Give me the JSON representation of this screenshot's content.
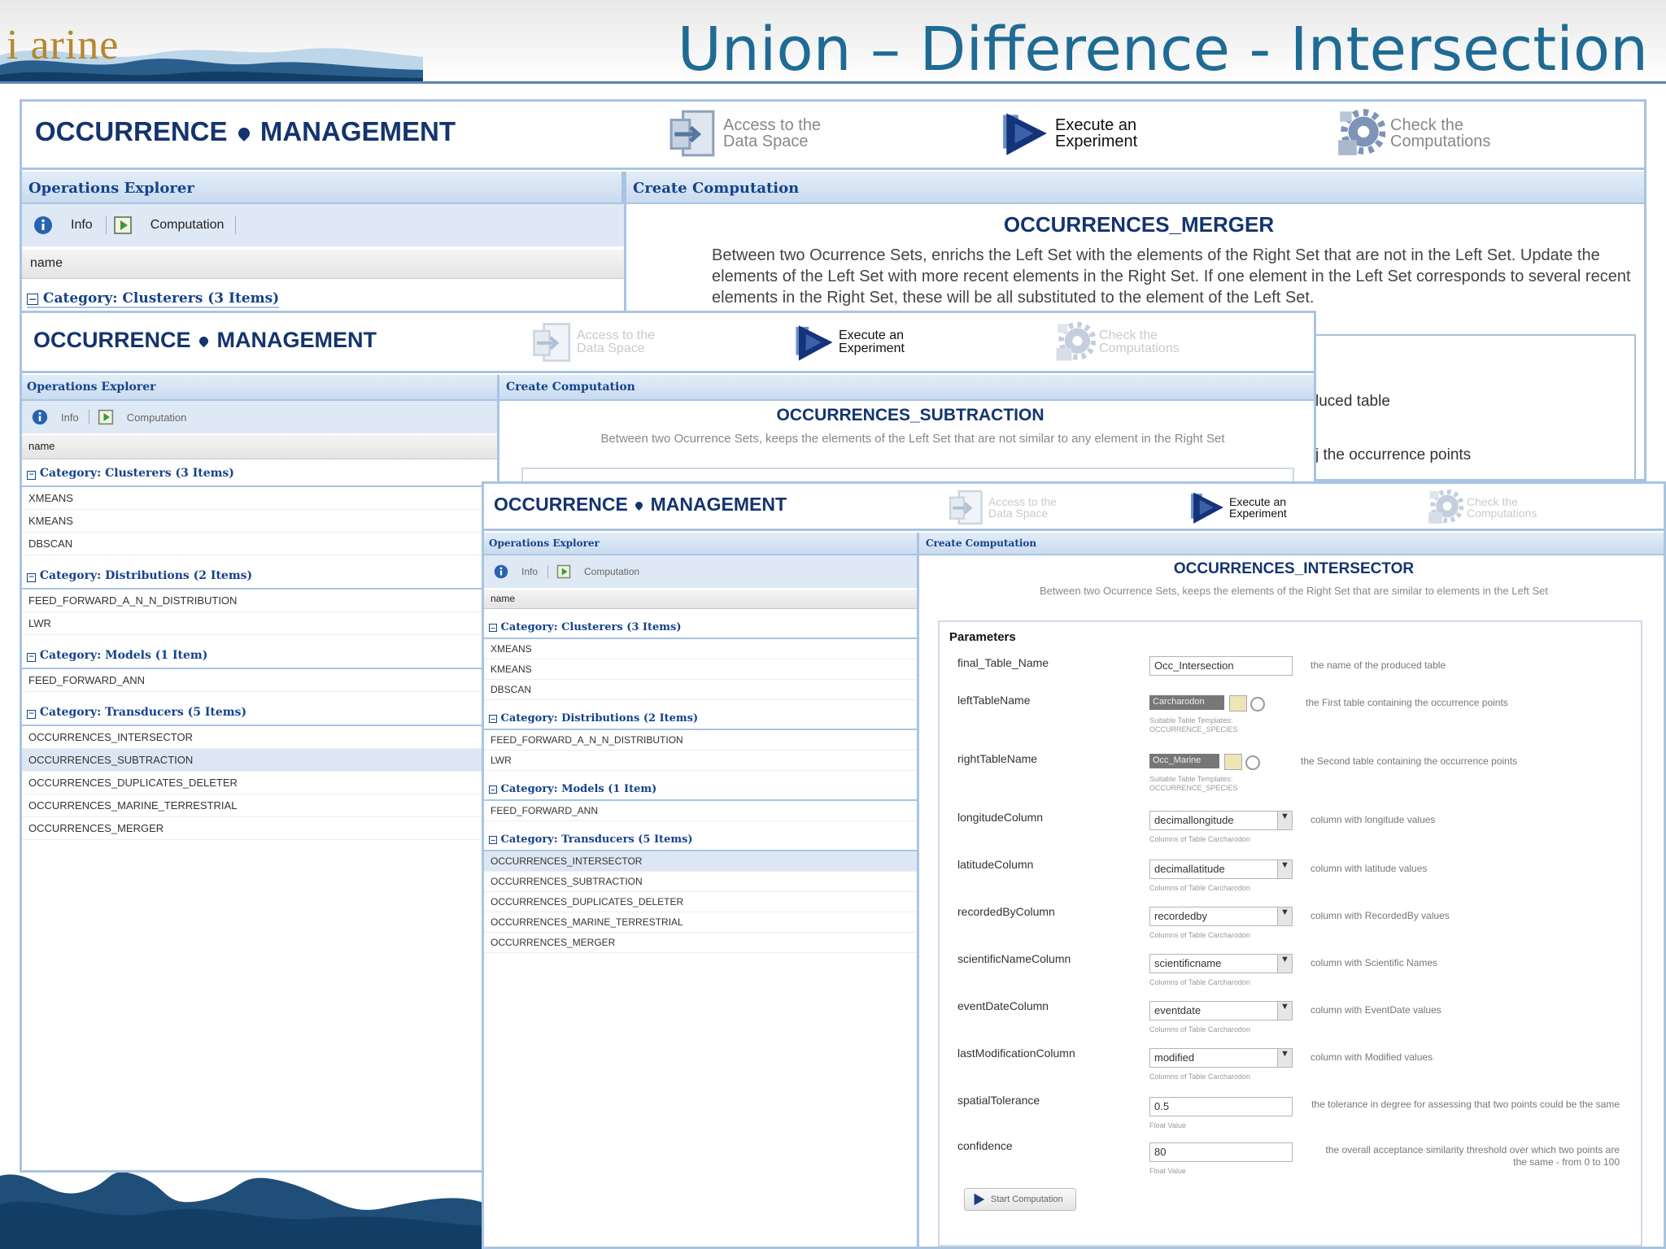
{
  "slide": {
    "title": "Union – Difference - Intersection",
    "logo_text": "i arine",
    "colors": {
      "title": "#1f6b94",
      "wave": "#1f4f78",
      "app_title": "#14346e",
      "section_header_text": "#15428b",
      "panel_border": "#a9c4e2"
    }
  },
  "app": {
    "title_left": "OCCURRENCE",
    "title_right": "MANAGEMENT",
    "nav": {
      "access": "Access to the\nData Space",
      "execute": "Execute an\nExperiment",
      "check": "Check the\nComputations"
    },
    "icons": [
      "access-data-space-icon",
      "execute-experiment-icon",
      "check-computations-icon",
      "info-icon",
      "computation-icon",
      "start-computation-icon",
      "collapse-icon"
    ],
    "explorer_title": "Operations Explorer",
    "computation_title": "Create Computation",
    "toolbar": {
      "info": "Info",
      "computation": "Computation"
    },
    "name_column": "name"
  },
  "categories": {
    "clusterers": {
      "label": "Category: Clusterers (3 Items)",
      "items": [
        "XMEANS",
        "KMEANS",
        "DBSCAN"
      ]
    },
    "distributions": {
      "label": "Category: Distributions (2 Items)",
      "items": [
        "FEED_FORWARD_A_N_N_DISTRIBUTION",
        "LWR"
      ]
    },
    "models": {
      "label": "Category: Models (1 Item)",
      "items": [
        "FEED_FORWARD_ANN"
      ]
    },
    "transducers": {
      "label": "Category: Transducers (5 Items)",
      "items": [
        "OCCURRENCES_INTERSECTOR",
        "OCCURRENCES_SUBTRACTION",
        "OCCURRENCES_DUPLICATES_DELETER",
        "OCCURRENCES_MARINE_TERRESTRIAL",
        "OCCURRENCES_MERGER"
      ]
    }
  },
  "merger": {
    "name": "OCCURRENCES_MERGER",
    "description": "Between two Ocurrence Sets, enrichs the Left Set with the elements of the Right Set that are not in the Left Set. Update the elements of the Left Set with more recent elements in the Right Set. If one element in the Left Set corresponds to several recent elements in the Right Set, these will be all substituted to the element of the Left Set.",
    "partial_texts": [
      "luced table",
      "j the occurrence points"
    ]
  },
  "subtraction": {
    "name": "OCCURRENCES_SUBTRACTION",
    "description": "Between two Ocurrence Sets, keeps the elements of the Left Set that are not similar to any element in the Right Set"
  },
  "intersector": {
    "name": "OCCURRENCES_INTERSECTOR",
    "description": "Between two Ocurrence Sets, keeps the elements of the Right Set that are similar to elements in the Left Set",
    "params_title": "Parameters",
    "start_label": "Start Computation",
    "params": {
      "final_table_name": {
        "label": "final_Table_Name",
        "value": "Occ_Intersection",
        "desc": "the name of the produced table"
      },
      "left_table_name": {
        "label": "leftTableName",
        "value": "Carcharodon",
        "desc": "the First table containing the occurrence points",
        "hint": "Suitable Table Templates:\nOCCURRENCE_SPECIES"
      },
      "right_table_name": {
        "label": "rightTableName",
        "value": "Occ_Marine",
        "desc": "the Second table containing the occurrence points",
        "hint": "Suitable Table Templates:\nOCCURRENCE_SPECIES"
      },
      "longitude_column": {
        "label": "longitudeColumn",
        "value": "decimallongitude",
        "desc": "column with longitude values",
        "hint": "Columns of Table Carcharodon"
      },
      "latitude_column": {
        "label": "latitudeColumn",
        "value": "decimallatitude",
        "desc": "column with latitude values",
        "hint": "Columns of Table Carcharodon"
      },
      "recorded_by_column": {
        "label": "recordedByColumn",
        "value": "recordedby",
        "desc": "column with RecordedBy values",
        "hint": "Columns of Table Carcharodon"
      },
      "scientific_name_column": {
        "label": "scientificNameColumn",
        "value": "scientificname",
        "desc": "column with Scientific Names",
        "hint": "Columns of Table Carcharodon"
      },
      "event_date_column": {
        "label": "eventDateColumn",
        "value": "eventdate",
        "desc": "column with EventDate values",
        "hint": "Columns of Table Carcharodon"
      },
      "last_modification_column": {
        "label": "lastModificationColumn",
        "value": "modified",
        "desc": "column with Modified values",
        "hint": "Columns of Table Carcharodon"
      },
      "spatial_tolerance": {
        "label": "spatialTolerance",
        "value": "0.5",
        "desc": "the tolerance in degree for assessing that two points could be the same",
        "hint": "Float Value"
      },
      "confidence": {
        "label": "confidence",
        "value": "80",
        "desc": "the overall acceptance similarity threshold over which two points are the same - from 0 to 100",
        "hint": "Float Value"
      }
    }
  }
}
